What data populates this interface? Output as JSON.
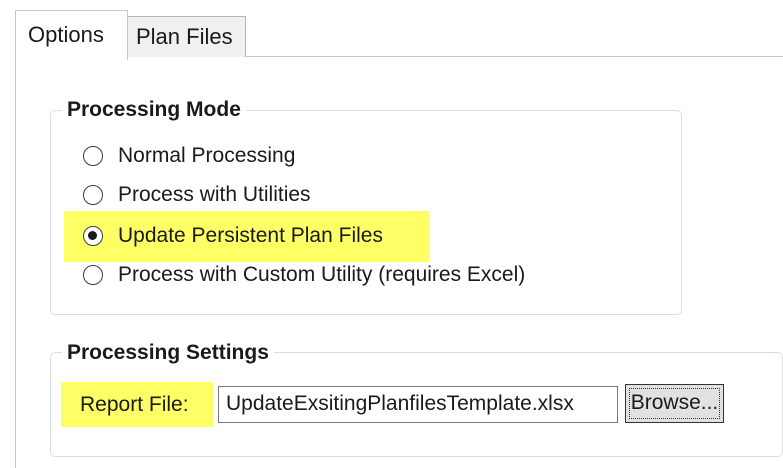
{
  "tabs": [
    {
      "label": "Options",
      "active": true
    },
    {
      "label": "Plan Files",
      "active": false
    }
  ],
  "processing_mode": {
    "title": "Processing Mode",
    "options": [
      {
        "label": "Normal Processing",
        "checked": false
      },
      {
        "label": "Process with Utilities",
        "checked": false
      },
      {
        "label": "Update Persistent Plan Files",
        "checked": true
      },
      {
        "label": "Process with Custom Utility (requires Excel)",
        "checked": false
      }
    ]
  },
  "processing_settings": {
    "title": "Processing Settings",
    "report_file_label": "Report File:",
    "report_file_value": "UpdateExsitingPlanfilesTemplate.xlsx",
    "browse_label": "Browse..."
  },
  "colors": {
    "highlight": "#ffff66",
    "groupbox_border": "#d5dfe5"
  }
}
